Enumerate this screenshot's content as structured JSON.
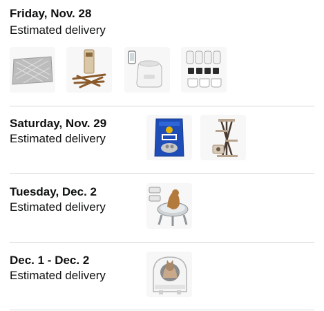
{
  "groups": [
    {
      "date": "Friday, Nov. 28",
      "subtitle": "Estimated delivery",
      "items": [
        {
          "icon": "litter-mat-icon"
        },
        {
          "icon": "cat-treat-sticks-icon"
        },
        {
          "icon": "automatic-feeder-icon"
        },
        {
          "icon": "feeder-accessories-set-icon"
        }
      ]
    },
    {
      "date": "Saturday, Nov. 29",
      "subtitle": "Estimated delivery",
      "items": [
        {
          "icon": "cat-litter-bag-icon"
        },
        {
          "icon": "cat-tree-icon"
        }
      ]
    },
    {
      "date": "Tuesday, Dec. 2",
      "subtitle": "Estimated delivery",
      "items": [
        {
          "icon": "elevated-cat-bed-icon"
        }
      ]
    },
    {
      "date": "Dec. 1 - Dec. 2",
      "subtitle": "Estimated delivery",
      "items": [
        {
          "icon": "hooded-litter-box-icon"
        }
      ]
    }
  ],
  "colors": {
    "text": "#0f1111",
    "divider": "#d5d9d9",
    "thumb_bg": "#f7f7f7"
  }
}
